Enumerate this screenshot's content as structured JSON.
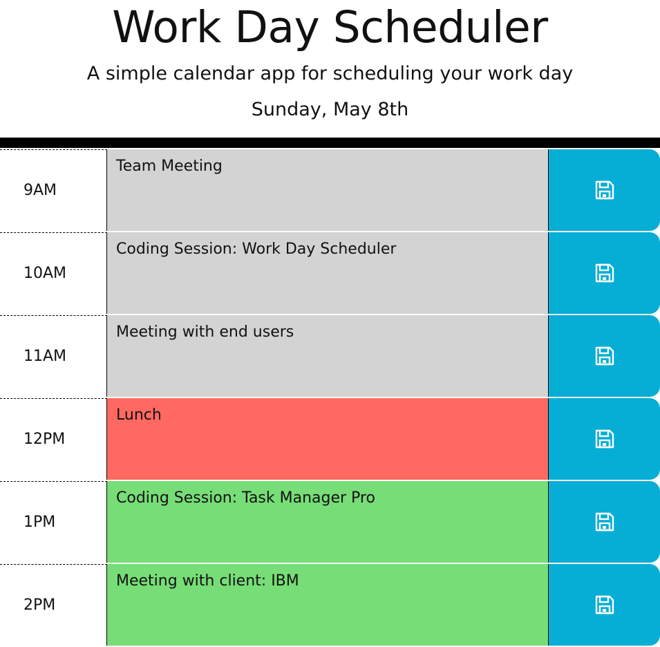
{
  "header": {
    "title": "Work Day Scheduler",
    "subtitle": "A simple calendar app for scheduling your work day",
    "current_day": "Sunday, May 8th"
  },
  "colors": {
    "past": "#d3d3d3",
    "present": "#ff6961",
    "future": "#77dd77",
    "save": "#06aed5"
  },
  "rows": [
    {
      "hour": "9AM",
      "text": "Team Meeting",
      "state": "past"
    },
    {
      "hour": "10AM",
      "text": "Coding Session: Work Day Scheduler",
      "state": "past"
    },
    {
      "hour": "11AM",
      "text": "Meeting with end users",
      "state": "past"
    },
    {
      "hour": "12PM",
      "text": "Lunch",
      "state": "present"
    },
    {
      "hour": "1PM",
      "text": "Coding Session: Task Manager Pro",
      "state": "future"
    },
    {
      "hour": "2PM",
      "text": "Meeting with client: IBM",
      "state": "future"
    }
  ],
  "save_icon": "floppy-disk-icon"
}
